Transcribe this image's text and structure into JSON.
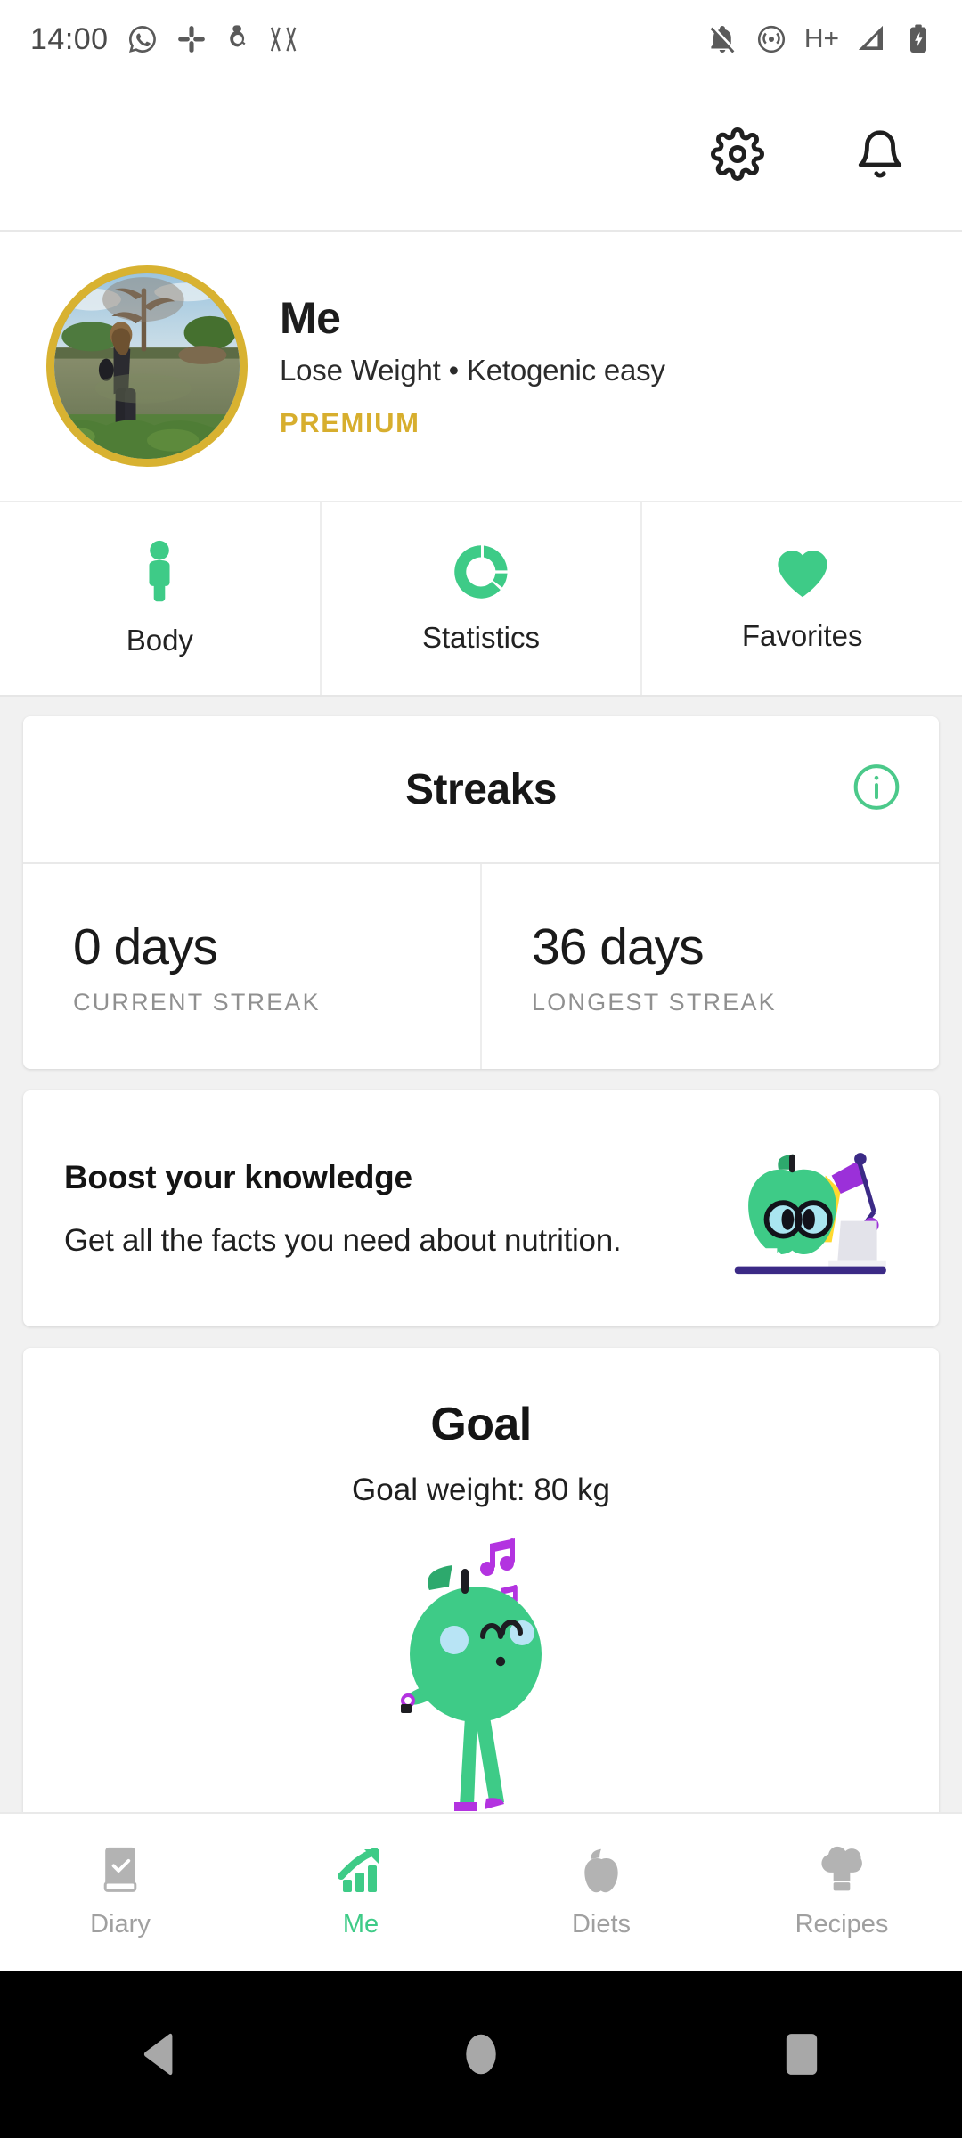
{
  "status_bar": {
    "time": "14:00",
    "left_icons": [
      "whatsapp-icon",
      "slack-icon",
      "app-icon",
      "vv-icon"
    ],
    "right_icons": [
      "notifications-muted-icon",
      "hotspot-icon",
      "signal-icon",
      "battery-charging-icon"
    ],
    "network_label": "H+"
  },
  "app_bar": {
    "settings_icon": "gear-icon",
    "notifications_icon": "bell-icon"
  },
  "profile": {
    "avatar_alt": "user-photo-lake",
    "name": "Me",
    "subtitle": "Lose Weight • Ketogenic easy",
    "badge": "PREMIUM",
    "badge_color": "#d7ae2e",
    "ring_color": "#d8b231"
  },
  "tiles": [
    {
      "label": "Body",
      "icon": "person-icon"
    },
    {
      "label": "Statistics",
      "icon": "donut-chart-icon"
    },
    {
      "label": "Favorites",
      "icon": "heart-icon"
    }
  ],
  "streaks": {
    "title": "Streaks",
    "info_icon": "info-circle-icon",
    "stats": [
      {
        "value": "0 days",
        "label": "CURRENT STREAK"
      },
      {
        "value": "36 days",
        "label": "LONGEST STREAK"
      }
    ]
  },
  "boost": {
    "title": "Boost your knowledge",
    "subtitle": "Get all the facts you need about nutrition.",
    "illustration": "apple-mascot-studying-icon"
  },
  "goal": {
    "title": "Goal",
    "weight_text": "Goal weight: 80 kg",
    "illustration": "apple-mascot-dancing-icon"
  },
  "bottom_nav": [
    {
      "label": "Diary",
      "icon": "diary-book-icon",
      "active": false
    },
    {
      "label": "Me",
      "icon": "growth-chart-icon",
      "active": true
    },
    {
      "label": "Diets",
      "icon": "apple-icon",
      "active": false
    },
    {
      "label": "Recipes",
      "icon": "chef-hat-icon",
      "active": false
    }
  ],
  "system_nav": [
    {
      "icon": "back-triangle-icon"
    },
    {
      "icon": "home-circle-icon"
    },
    {
      "icon": "recents-square-icon"
    }
  ],
  "colors": {
    "accent_green": "#3ecb87",
    "gold": "#d7ae2e",
    "page_bg": "#f1f1f1",
    "purple": "#9b30d9"
  }
}
